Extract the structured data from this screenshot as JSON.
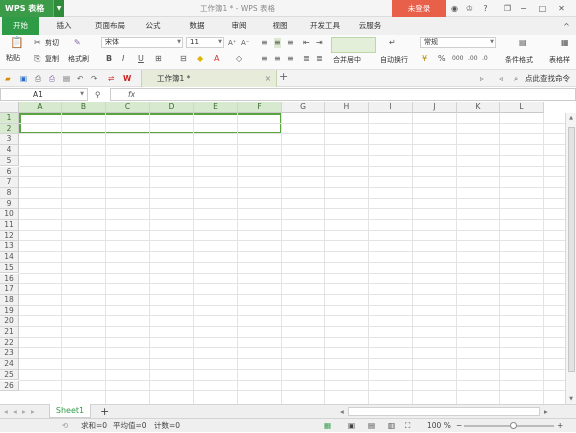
{
  "app": {
    "name": "WPS 表格",
    "window_title": "工作簿1 * - WPS 表格",
    "login_label": "未登录"
  },
  "tabs": [
    "开始",
    "插入",
    "页面布局",
    "公式",
    "数据",
    "审阅",
    "视图",
    "开发工具",
    "云服务"
  ],
  "active_tab": "开始",
  "ribbon": {
    "paste": "粘贴",
    "cut": "剪切",
    "copy": "复制",
    "format_painter": "格式刷",
    "font_name": "宋体",
    "font_size": "11",
    "bold": "B",
    "italic": "I",
    "underline": "U",
    "merge_center": "合并居中",
    "wrap_text": "自动换行",
    "number_format": "常规",
    "conditional_format": "条件格式",
    "table_style": "表格样"
  },
  "quickbar": {
    "doc_tab": "工作簿1 *",
    "search_cmd": "点此查找命令"
  },
  "formula_bar": {
    "name_box": "A1",
    "fx": "fx"
  },
  "grid": {
    "columns": [
      "A",
      "B",
      "C",
      "D",
      "E",
      "F",
      "G",
      "H",
      "I",
      "J",
      "K",
      "L"
    ],
    "rows": [
      "1",
      "2",
      "3",
      "4",
      "5",
      "6",
      "7",
      "8",
      "9",
      "10",
      "11",
      "12",
      "13",
      "14",
      "15",
      "16",
      "17",
      "18",
      "19",
      "20",
      "21",
      "22",
      "23",
      "24",
      "25",
      "26"
    ],
    "selected_range": "A1:F2"
  },
  "sheets": {
    "active": "Sheet1"
  },
  "status": {
    "sum": "求和=0",
    "average": "平均值=0",
    "count": "计数=0",
    "zoom": "100 %"
  },
  "colors": {
    "accent": "#2e9b47",
    "login": "#e8604a",
    "selection": "#5aa540"
  }
}
